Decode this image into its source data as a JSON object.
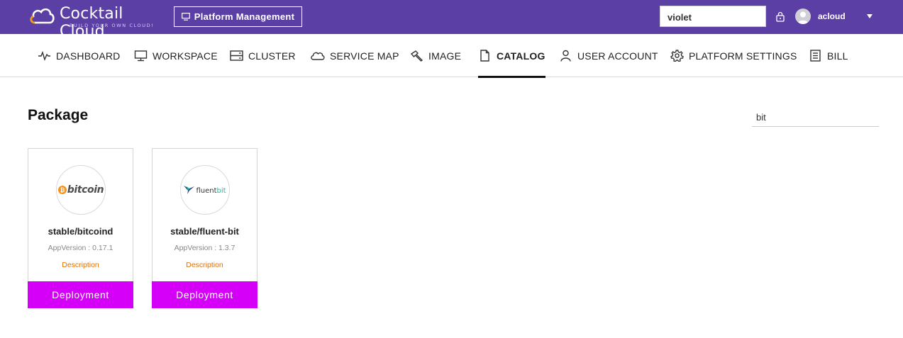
{
  "brand": {
    "name": "Cocktail Cloud",
    "tagline": "BUILD YOUR OWN CLOUD!",
    "logo_colors": [
      "#f39c12",
      "#ffffff"
    ]
  },
  "header": {
    "platform_button": "Platform Management",
    "account_value": "violet",
    "user_name": "acloud",
    "colors": {
      "bar": "#5b3fa5"
    }
  },
  "nav": {
    "items": [
      {
        "label": "DASHBOARD",
        "icon": "pulse-icon"
      },
      {
        "label": "WORKSPACE",
        "icon": "monitor-icon"
      },
      {
        "label": "CLUSTER",
        "icon": "server-icon"
      },
      {
        "label": "SERVICE MAP",
        "icon": "cloud-icon"
      },
      {
        "label": "IMAGE",
        "icon": "hammer-icon"
      },
      {
        "label": "CATALOG",
        "icon": "document-icon",
        "active": true
      },
      {
        "label": "USER ACCOUNT",
        "icon": "user-icon"
      },
      {
        "label": "PLATFORM SETTINGS",
        "icon": "gear-icon"
      },
      {
        "label": "BILL",
        "icon": "bill-icon"
      }
    ]
  },
  "main": {
    "title": "Package",
    "search_value": "bit",
    "packages": [
      {
        "name": "stable/bitcoind",
        "app_version": "AppVersion : 0.17.1",
        "description_link": "Description",
        "deploy_label": "Deployment",
        "logo_text": "bitcoin",
        "logo_icon": "bitcoin-coin-icon"
      },
      {
        "name": "stable/fluent-bit",
        "app_version": "AppVersion : 1.3.7",
        "description_link": "Description",
        "deploy_label": "Deployment",
        "logo_text_main": "fluent",
        "logo_text_accent": "bit",
        "logo_icon": "fluentbit-bird-icon"
      }
    ],
    "colors": {
      "deploy": "#d400f7",
      "description": "#e07000"
    }
  }
}
